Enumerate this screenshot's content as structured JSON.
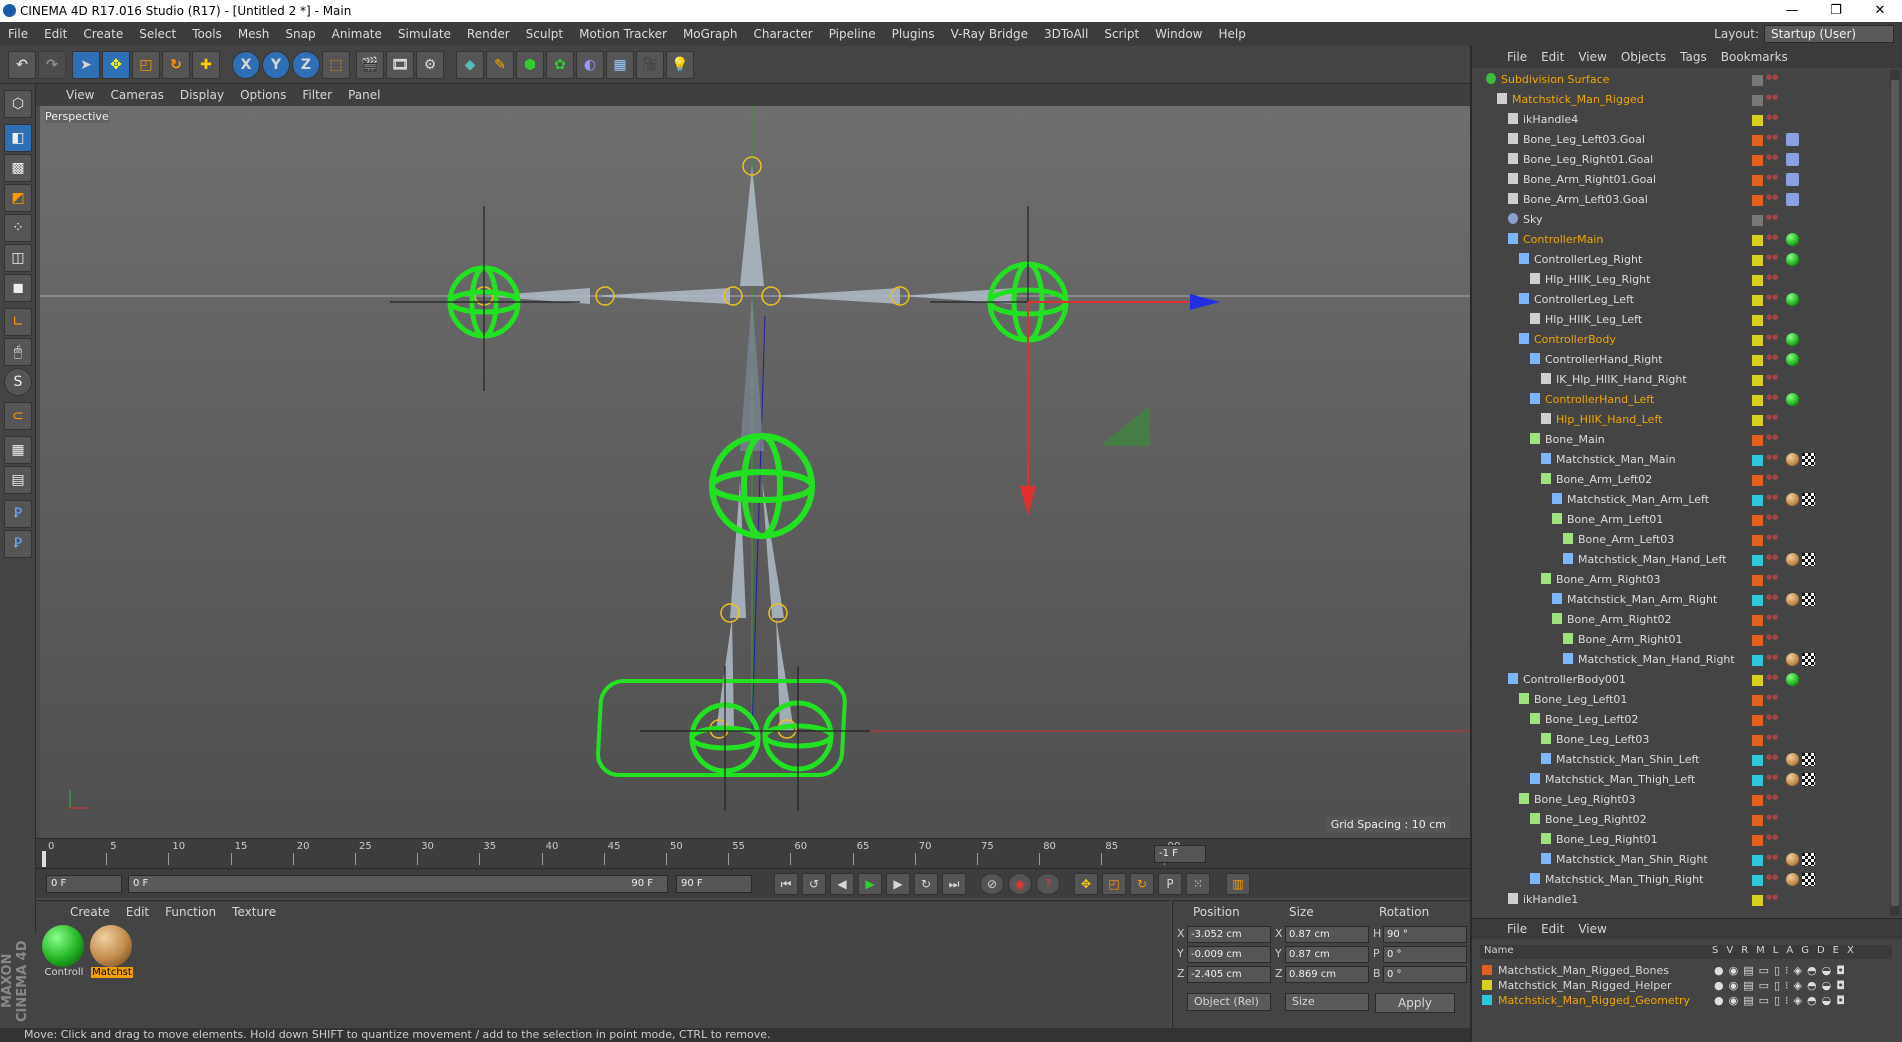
{
  "window": {
    "title": "CINEMA 4D R17.016 Studio (R17) - [Untitled 2 *] - Main",
    "minimize": "—",
    "restore": "❐",
    "close": "✕"
  },
  "menu": {
    "items": [
      "File",
      "Edit",
      "Create",
      "Select",
      "Tools",
      "Mesh",
      "Snap",
      "Animate",
      "Simulate",
      "Render",
      "Sculpt",
      "Motion Tracker",
      "MoGraph",
      "Character",
      "Pipeline",
      "Plugins",
      "V-Ray Bridge",
      "3DToAll",
      "Script",
      "Window",
      "Help"
    ],
    "layout_label": "Layout:",
    "layout_value": "Startup (User)"
  },
  "toolbar": {
    "x_label": "X",
    "y_label": "Y",
    "z_label": "Z"
  },
  "viewport": {
    "menu": [
      "View",
      "Cameras",
      "Display",
      "Options",
      "Filter",
      "Panel"
    ],
    "view_name": "Perspective",
    "grid_spacing": "Grid Spacing : 10 cm"
  },
  "timeline": {
    "ticks": [
      "0",
      "5",
      "10",
      "15",
      "20",
      "25",
      "30",
      "35",
      "40",
      "45",
      "50",
      "55",
      "60",
      "65",
      "70",
      "75",
      "80",
      "85",
      "90"
    ],
    "frame_end_indicator": "-1 F"
  },
  "controls": {
    "current_frame": "0 F",
    "range_start": "0 F",
    "range_end": "90 F",
    "max_frame": "90 F"
  },
  "materials": {
    "menu": [
      "Create",
      "Edit",
      "Function",
      "Texture"
    ],
    "items": [
      {
        "label": "Controll",
        "color": "#22b222"
      },
      {
        "label": "Matchst",
        "color": "#c08a4a"
      }
    ]
  },
  "coords": {
    "headers": {
      "position": "Position",
      "size": "Size",
      "rotation": "Rotation"
    },
    "axis": [
      "X",
      "Y",
      "Z"
    ],
    "rot_axis": [
      "H",
      "P",
      "B"
    ],
    "position": [
      "-3.052 cm",
      "-0.009 cm",
      "-2.405 cm"
    ],
    "size": [
      "0.87 cm",
      "0.87 cm",
      "0.869 cm"
    ],
    "rotation": [
      "90 °",
      "0 °",
      "0 °"
    ],
    "mode": "Object (Rel)",
    "size_mode": "Size",
    "apply": "Apply"
  },
  "status": "Move: Click and drag to move elements. Hold down SHIFT to quantize movement / add to the selection in point mode, CTRL to remove.",
  "object_manager": {
    "menu": [
      "File",
      "Edit",
      "View",
      "Objects",
      "Tags",
      "Bookmarks"
    ],
    "rows": [
      {
        "name": "Subdivision Surface",
        "indent": 0,
        "hl": true,
        "layer": "#777777",
        "kind": "sds"
      },
      {
        "name": "Matchstick_Man_Rigged",
        "indent": 1,
        "hl": true,
        "layer": "#777777",
        "kind": "null"
      },
      {
        "name": "ikHandle4",
        "indent": 2,
        "hl": false,
        "layer": "#d8d020",
        "kind": "null"
      },
      {
        "name": "Bone_Leg_Left03.Goal",
        "indent": 2,
        "hl": false,
        "layer": "#e06020",
        "kind": "null"
      },
      {
        "name": "Bone_Leg_Right01.Goal",
        "indent": 2,
        "hl": false,
        "layer": "#e06020",
        "kind": "null"
      },
      {
        "name": "Bone_Arm_Right01.Goal",
        "indent": 2,
        "hl": false,
        "layer": "#e06020",
        "kind": "null"
      },
      {
        "name": "Bone_Arm_Left03.Goal",
        "indent": 2,
        "hl": false,
        "layer": "#e06020",
        "kind": "null"
      },
      {
        "name": "Sky",
        "indent": 2,
        "hl": false,
        "layer": "#777777",
        "kind": "sky"
      },
      {
        "name": "ControllerMain",
        "indent": 2,
        "hl": true,
        "layer": "#d8d020",
        "kind": "joint"
      },
      {
        "name": "ControllerLeg_Right",
        "indent": 3,
        "hl": false,
        "layer": "#d8d020",
        "kind": "joint"
      },
      {
        "name": "Hlp_HIIK_Leg_Right",
        "indent": 4,
        "hl": false,
        "layer": "#d8d020",
        "kind": "null"
      },
      {
        "name": "ControllerLeg_Left",
        "indent": 3,
        "hl": false,
        "layer": "#d8d020",
        "kind": "joint"
      },
      {
        "name": "Hlp_HIIK_Leg_Left",
        "indent": 4,
        "hl": false,
        "layer": "#d8d020",
        "kind": "null"
      },
      {
        "name": "ControllerBody",
        "indent": 3,
        "hl": true,
        "layer": "#d8d020",
        "kind": "joint"
      },
      {
        "name": "ControllerHand_Right",
        "indent": 4,
        "hl": false,
        "layer": "#d8d020",
        "kind": "joint"
      },
      {
        "name": "IK_Hlp_HIIK_Hand_Right",
        "indent": 5,
        "hl": false,
        "layer": "#d8d020",
        "kind": "null"
      },
      {
        "name": "ControllerHand_Left",
        "indent": 4,
        "hl": true,
        "layer": "#d8d020",
        "kind": "joint"
      },
      {
        "name": "Hlp_HIIK_Hand_Left",
        "indent": 5,
        "hl": true,
        "layer": "#d8d020",
        "kind": "null"
      },
      {
        "name": "Bone_Main",
        "indent": 4,
        "hl": false,
        "layer": "#e06020",
        "kind": "bone"
      },
      {
        "name": "Matchstick_Man_Main",
        "indent": 5,
        "hl": false,
        "layer": "#30c8d8",
        "kind": "joint"
      },
      {
        "name": "Bone_Arm_Left02",
        "indent": 5,
        "hl": false,
        "layer": "#e06020",
        "kind": "bone"
      },
      {
        "name": "Matchstick_Man_Arm_Left",
        "indent": 6,
        "hl": false,
        "layer": "#30c8d8",
        "kind": "joint"
      },
      {
        "name": "Bone_Arm_Left01",
        "indent": 6,
        "hl": false,
        "layer": "#e06020",
        "kind": "bone"
      },
      {
        "name": "Bone_Arm_Left03",
        "indent": 7,
        "hl": false,
        "layer": "#e06020",
        "kind": "bone"
      },
      {
        "name": "Matchstick_Man_Hand_Left",
        "indent": 7,
        "hl": false,
        "layer": "#30c8d8",
        "kind": "joint"
      },
      {
        "name": "Bone_Arm_Right03",
        "indent": 5,
        "hl": false,
        "layer": "#e06020",
        "kind": "bone"
      },
      {
        "name": "Matchstick_Man_Arm_Right",
        "indent": 6,
        "hl": false,
        "layer": "#30c8d8",
        "kind": "joint"
      },
      {
        "name": "Bone_Arm_Right02",
        "indent": 6,
        "hl": false,
        "layer": "#e06020",
        "kind": "bone"
      },
      {
        "name": "Bone_Arm_Right01",
        "indent": 7,
        "hl": false,
        "layer": "#e06020",
        "kind": "bone"
      },
      {
        "name": "Matchstick_Man_Hand_Right",
        "indent": 7,
        "hl": false,
        "layer": "#30c8d8",
        "kind": "joint"
      },
      {
        "name": "ControllerBody001",
        "indent": 2,
        "hl": false,
        "layer": "#d8d020",
        "kind": "joint"
      },
      {
        "name": "Bone_Leg_Left01",
        "indent": 3,
        "hl": false,
        "layer": "#e06020",
        "kind": "bone"
      },
      {
        "name": "Bone_Leg_Left02",
        "indent": 4,
        "hl": false,
        "layer": "#e06020",
        "kind": "bone"
      },
      {
        "name": "Bone_Leg_Left03",
        "indent": 5,
        "hl": false,
        "layer": "#e06020",
        "kind": "bone"
      },
      {
        "name": "Matchstick_Man_Shin_Left",
        "indent": 5,
        "hl": false,
        "layer": "#30c8d8",
        "kind": "joint"
      },
      {
        "name": "Matchstick_Man_Thigh_Left",
        "indent": 4,
        "hl": false,
        "layer": "#30c8d8",
        "kind": "joint"
      },
      {
        "name": "Bone_Leg_Right03",
        "indent": 3,
        "hl": false,
        "layer": "#e06020",
        "kind": "bone"
      },
      {
        "name": "Bone_Leg_Right02",
        "indent": 4,
        "hl": false,
        "layer": "#e06020",
        "kind": "bone"
      },
      {
        "name": "Bone_Leg_Right01",
        "indent": 5,
        "hl": false,
        "layer": "#e06020",
        "kind": "bone"
      },
      {
        "name": "Matchstick_Man_Shin_Right",
        "indent": 5,
        "hl": false,
        "layer": "#30c8d8",
        "kind": "joint"
      },
      {
        "name": "Matchstick_Man_Thigh_Right",
        "indent": 4,
        "hl": false,
        "layer": "#30c8d8",
        "kind": "joint"
      },
      {
        "name": "ikHandle1",
        "indent": 2,
        "hl": false,
        "layer": "#d8d020",
        "kind": "null"
      }
    ]
  },
  "layer_manager": {
    "menu": [
      "File",
      "Edit",
      "View"
    ],
    "header": {
      "name": "Name",
      "cols": [
        "S",
        "V",
        "R",
        "M",
        "L",
        "A",
        "G",
        "D",
        "E",
        "X"
      ]
    },
    "layers": [
      {
        "name": "Matchstick_Man_Rigged_Bones",
        "color": "#e06020",
        "hl": false
      },
      {
        "name": "Matchstick_Man_Rigged_Helper",
        "color": "#d8d020",
        "hl": false
      },
      {
        "name": "Matchstick_Man_Rigged_Geometry",
        "color": "#30c8d8",
        "hl": true
      }
    ]
  }
}
